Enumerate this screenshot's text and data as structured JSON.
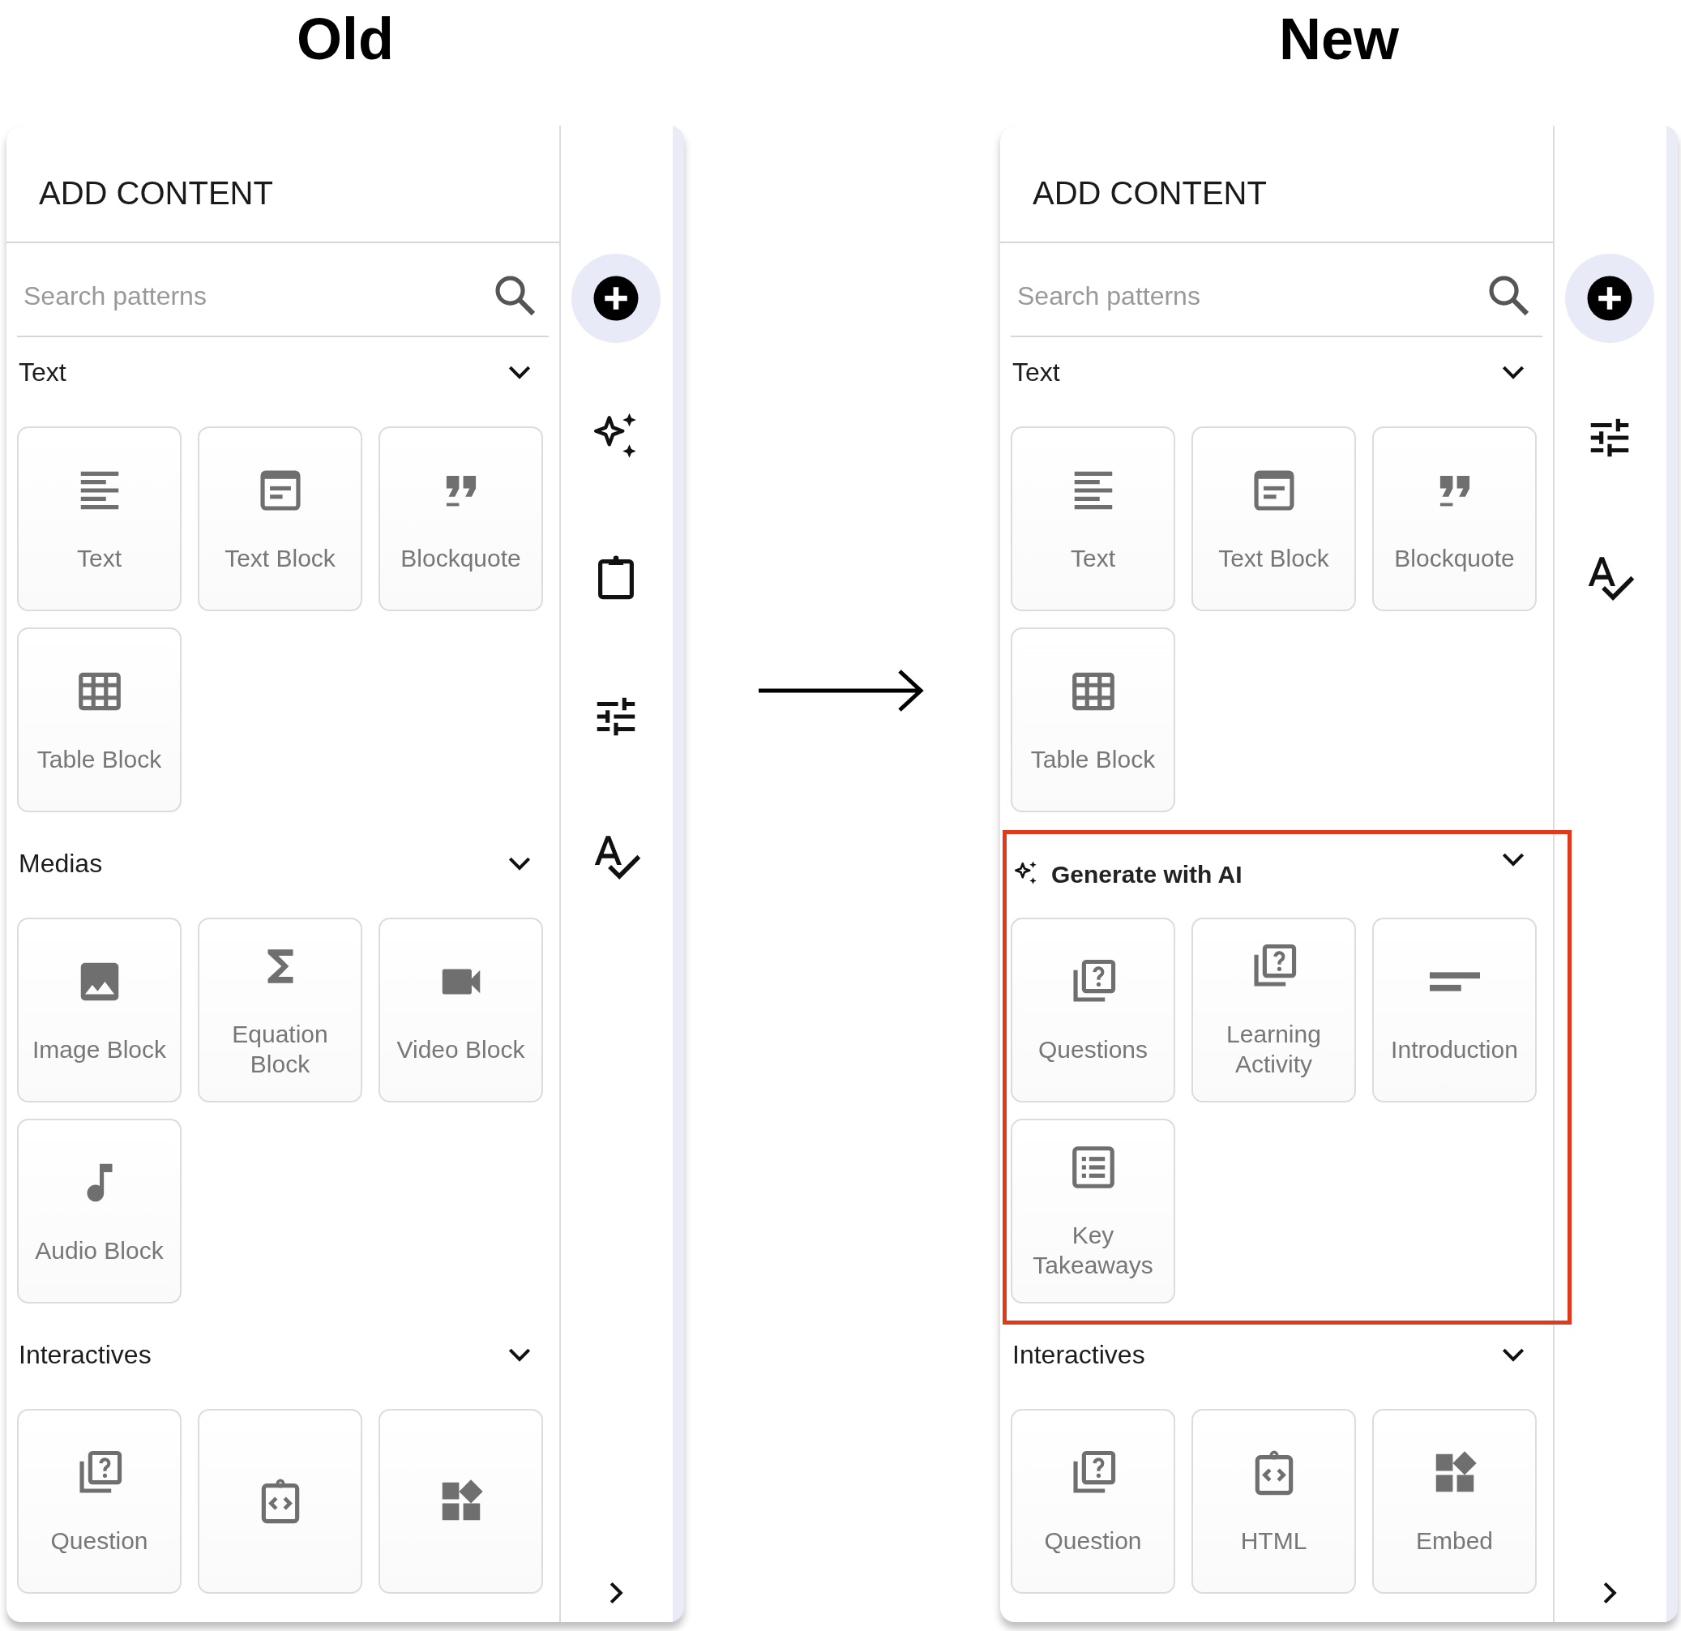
{
  "columns": [
    {
      "heading": "Old",
      "panel": {
        "title": "ADD CONTENT",
        "search": {
          "placeholder": "Search patterns"
        },
        "sections": [
          {
            "title": "Text",
            "kind": "plain",
            "highlighted": false,
            "expanded": true,
            "items": [
              {
                "kind": "text",
                "label": "Text"
              },
              {
                "kind": "text-block",
                "label": "Text Block"
              },
              {
                "kind": "quote",
                "label": "Blockquote"
              },
              {
                "kind": "table",
                "label": "Table Block"
              }
            ]
          },
          {
            "title": "Medias",
            "kind": "plain",
            "highlighted": false,
            "expanded": true,
            "items": [
              {
                "kind": "image",
                "label": "Image Block"
              },
              {
                "kind": "sigma",
                "label": "Equation Block"
              },
              {
                "kind": "video",
                "label": "Video Block"
              },
              {
                "kind": "music",
                "label": "Audio Block"
              }
            ]
          },
          {
            "title": "Interactives",
            "kind": "plain",
            "highlighted": false,
            "expanded": true,
            "items": [
              {
                "kind": "question",
                "label": "Question"
              },
              {
                "kind": "code"
              },
              {
                "kind": "widgets"
              }
            ]
          }
        ],
        "rail": [
          {
            "kind": "add",
            "selected": true
          },
          {
            "kind": "sparkles",
            "selected": false
          },
          {
            "kind": "clipboard",
            "selected": false
          },
          {
            "kind": "tune",
            "selected": false
          },
          {
            "kind": "spellcheck",
            "selected": false
          }
        ]
      }
    },
    {
      "heading": "New",
      "panel": {
        "title": "ADD CONTENT",
        "search": {
          "placeholder": "Search patterns"
        },
        "sections": [
          {
            "title": "Text",
            "kind": "plain",
            "highlighted": false,
            "expanded": true,
            "items": [
              {
                "kind": "text",
                "label": "Text"
              },
              {
                "kind": "text-block",
                "label": "Text Block"
              },
              {
                "kind": "quote",
                "label": "Blockquote"
              },
              {
                "kind": "table",
                "label": "Table Block"
              }
            ]
          },
          {
            "title": "Generate with AI",
            "kind": "ai",
            "highlighted": true,
            "expanded": true,
            "items": [
              {
                "kind": "question",
                "label": "Questions"
              },
              {
                "kind": "question",
                "label": "Learning Activity"
              },
              {
                "kind": "short-lines",
                "label": "Introduction"
              },
              {
                "kind": "list",
                "label": "Key Takeaways"
              }
            ]
          },
          {
            "title": "Interactives",
            "kind": "plain",
            "highlighted": false,
            "expanded": true,
            "items": [
              {
                "kind": "question",
                "label": "Question"
              },
              {
                "kind": "code",
                "label": "HTML"
              },
              {
                "kind": "widgets",
                "label": "Embed"
              }
            ]
          }
        ],
        "rail": [
          {
            "kind": "add",
            "selected": true
          },
          {
            "kind": "tune",
            "selected": false
          },
          {
            "kind": "spellcheck",
            "selected": false
          }
        ]
      }
    }
  ]
}
